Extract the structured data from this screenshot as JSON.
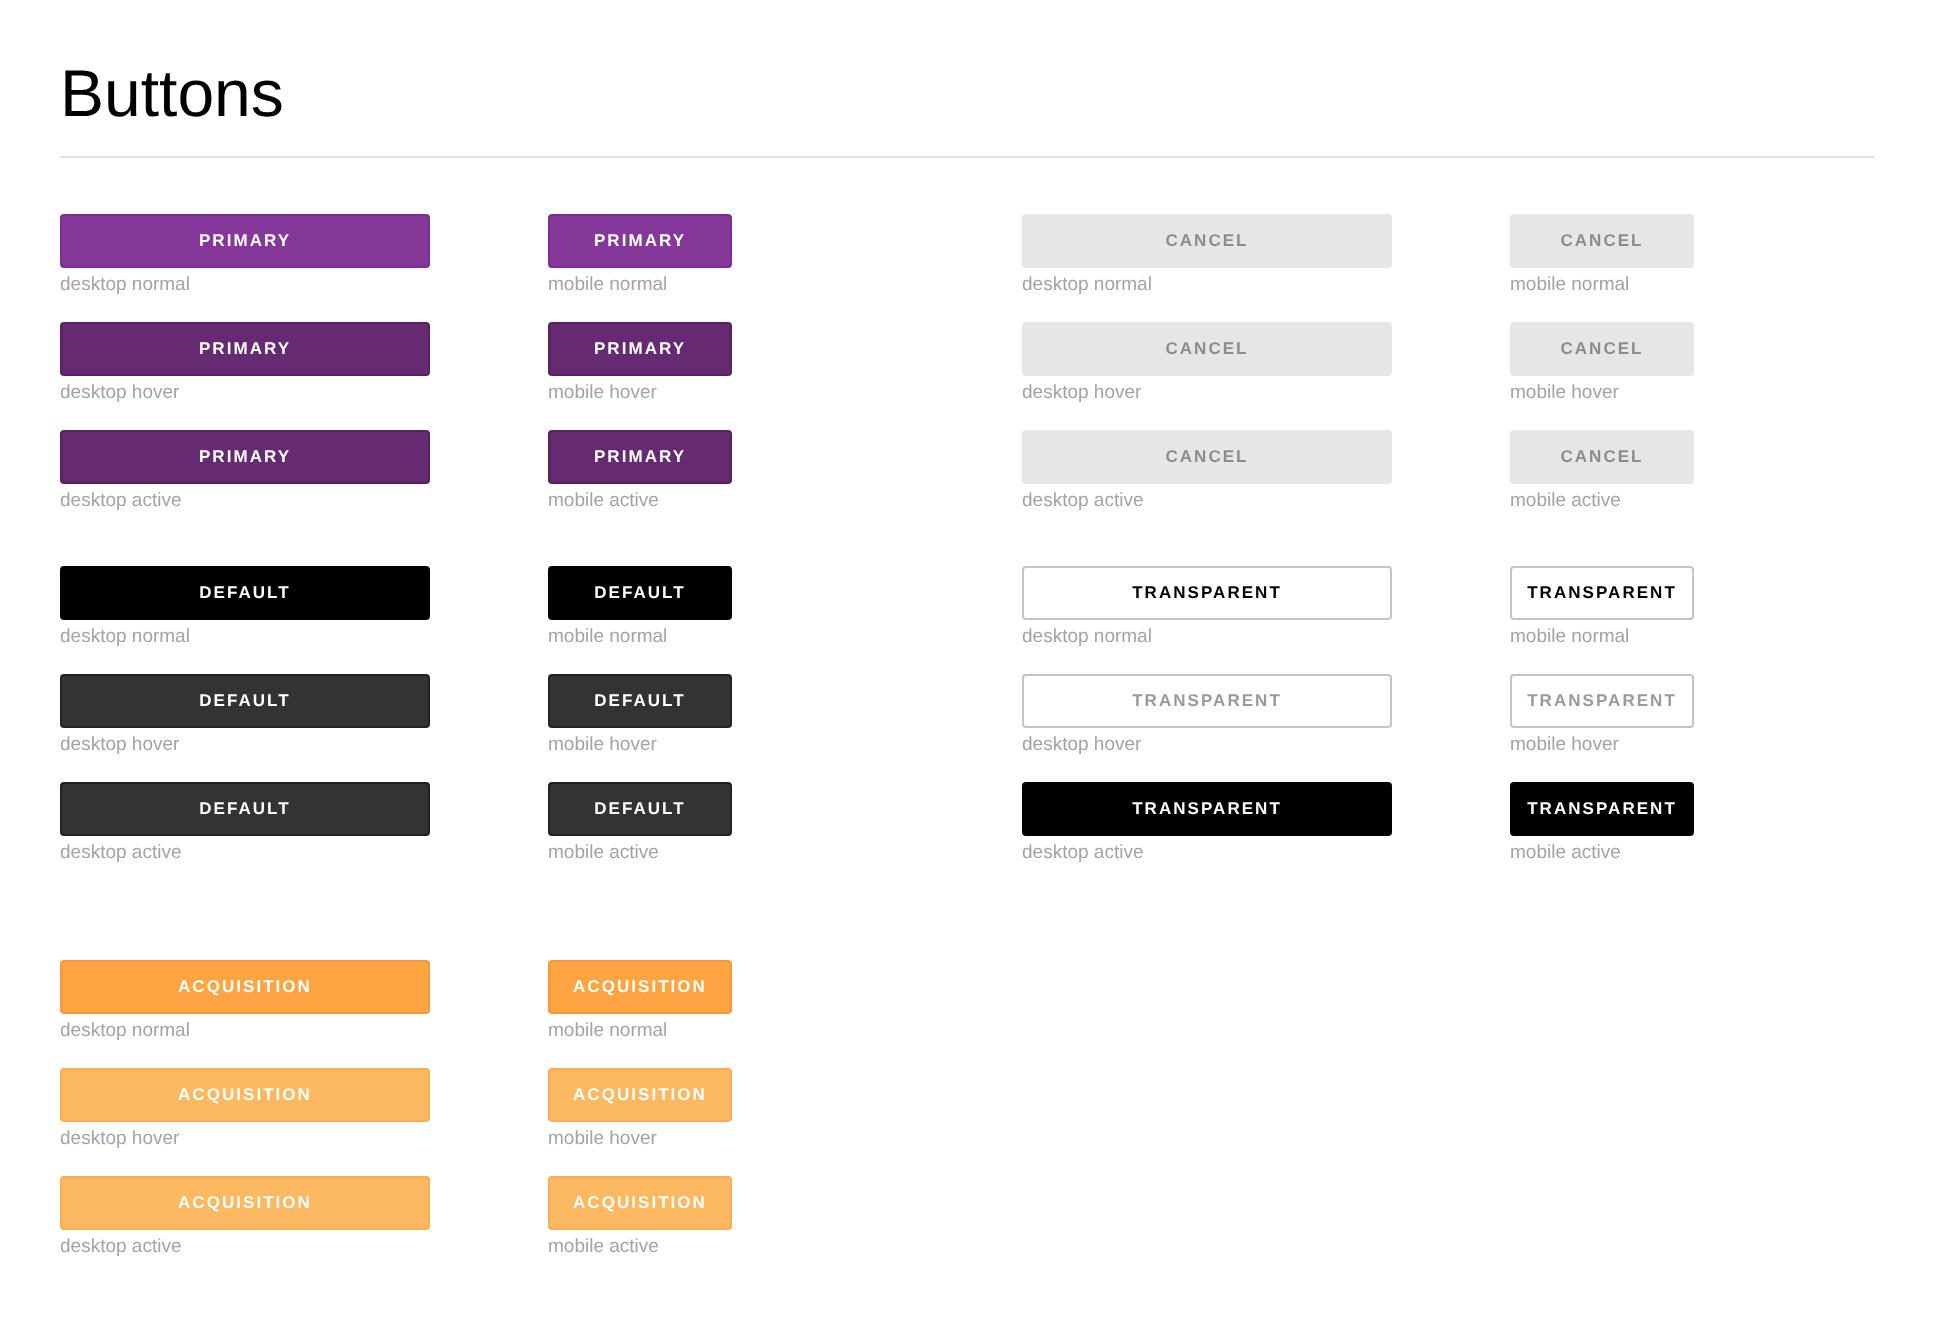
{
  "title": "Buttons",
  "sections": [
    {
      "groups": [
        {
          "kind": "primary",
          "rows": [
            {
              "hovered": false,
              "desktop": {
                "label": "PRIMARY",
                "caption": "desktop normal"
              },
              "mobile": {
                "label": "PRIMARY",
                "caption": "mobile normal"
              }
            },
            {
              "hovered": true,
              "desktop": {
                "label": "PRIMARY",
                "caption": "desktop hover"
              },
              "mobile": {
                "label": "PRIMARY",
                "caption": "mobile hover"
              }
            },
            {
              "hovered": true,
              "desktop": {
                "label": "PRIMARY",
                "caption": "desktop active"
              },
              "mobile": {
                "label": "PRIMARY",
                "caption": "mobile active"
              }
            }
          ]
        },
        {
          "kind": "cancel",
          "rows": [
            {
              "desktop": {
                "label": "CANCEL",
                "caption": "desktop normal"
              },
              "mobile": {
                "label": "CANCEL",
                "caption": "mobile normal"
              }
            },
            {
              "desktop": {
                "label": "CANCEL",
                "caption": "desktop hover"
              },
              "mobile": {
                "label": "CANCEL",
                "caption": "mobile hover"
              }
            },
            {
              "desktop": {
                "label": "CANCEL",
                "caption": "desktop active"
              },
              "mobile": {
                "label": "CANCEL",
                "caption": "mobile active"
              }
            }
          ]
        }
      ]
    },
    {
      "groups": [
        {
          "kind": "default",
          "rows": [
            {
              "hovered": false,
              "desktop": {
                "label": "DEFAULT",
                "caption": "desktop normal"
              },
              "mobile": {
                "label": "DEFAULT",
                "caption": "mobile normal"
              }
            },
            {
              "hovered": true,
              "desktop": {
                "label": "DEFAULT",
                "caption": "desktop hover"
              },
              "mobile": {
                "label": "DEFAULT",
                "caption": "mobile hover"
              }
            },
            {
              "hovered": true,
              "desktop": {
                "label": "DEFAULT",
                "caption": "desktop active"
              },
              "mobile": {
                "label": "DEFAULT",
                "caption": "mobile active"
              }
            }
          ]
        },
        {
          "kind": "transparent",
          "rows": [
            {
              "hovered": false,
              "pressed": false,
              "desktop": {
                "label": "TRANSPARENT",
                "caption": "desktop normal"
              },
              "mobile": {
                "label": "TRANSPARENT",
                "caption": "mobile normal"
              }
            },
            {
              "hovered": true,
              "pressed": false,
              "desktop": {
                "label": "TRANSPARENT",
                "caption": "desktop hover"
              },
              "mobile": {
                "label": "TRANSPARENT",
                "caption": "mobile hover"
              }
            },
            {
              "pressed": true,
              "desktop": {
                "label": "TRANSPARENT",
                "caption": "desktop active"
              },
              "mobile": {
                "label": "TRANSPARENT",
                "caption": "mobile active"
              }
            }
          ]
        }
      ]
    },
    {
      "groups": [
        {
          "kind": "acquisition",
          "rows": [
            {
              "hovered": false,
              "desktop": {
                "label": "ACQUISITION",
                "caption": "desktop normal"
              },
              "mobile": {
                "label": "ACQUISITION",
                "caption": "mobile normal"
              }
            },
            {
              "hovered": true,
              "desktop": {
                "label": "ACQUISITION",
                "caption": "desktop hover"
              },
              "mobile": {
                "label": "ACQUISITION",
                "caption": "mobile hover"
              }
            },
            {
              "hovered": true,
              "desktop": {
                "label": "ACQUISITION",
                "caption": "desktop active"
              },
              "mobile": {
                "label": "ACQUISITION",
                "caption": "mobile active"
              }
            }
          ]
        }
      ]
    }
  ]
}
